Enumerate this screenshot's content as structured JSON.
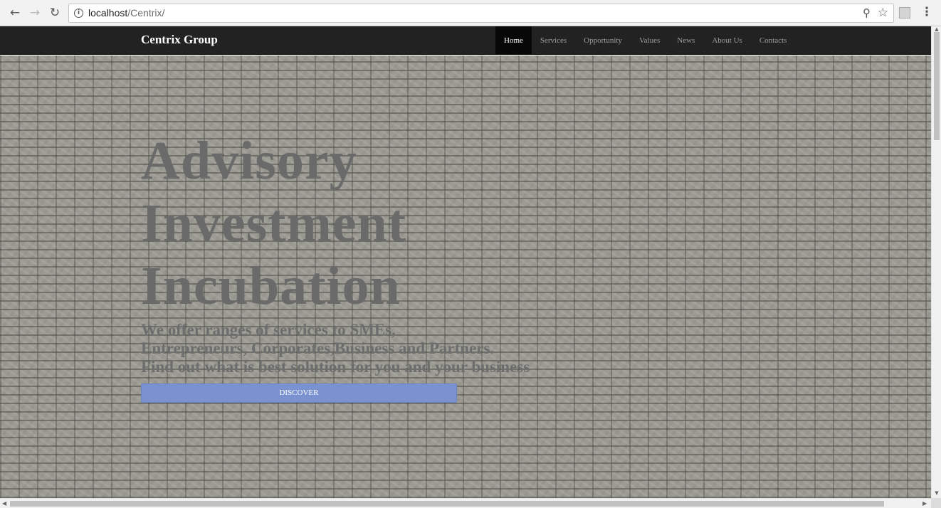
{
  "browser": {
    "url_host": "localhost",
    "url_path": "/Centrix/",
    "icons": {
      "back": "arrow-left-icon",
      "forward": "arrow-right-icon",
      "reload": "reload-icon",
      "info": "info-icon",
      "zoom": "zoom-icon",
      "bookmark": "star-icon",
      "extension": "extension-icon",
      "menu": "kebab-menu-icon"
    }
  },
  "site": {
    "brand": "Centrix Group",
    "nav": [
      {
        "label": "Home",
        "active": true
      },
      {
        "label": "Services",
        "active": false
      },
      {
        "label": "Opportunity",
        "active": false
      },
      {
        "label": "Values",
        "active": false
      },
      {
        "label": "News",
        "active": false
      },
      {
        "label": "About Us",
        "active": false
      },
      {
        "label": "Contacts",
        "active": false
      }
    ]
  },
  "hero": {
    "headline": [
      "Advisory",
      "Investment",
      "Incubation"
    ],
    "subtext": [
      "We offer ranges of services to SMEs,",
      "Entrepreneurs, Corporates,Business and Partners.",
      "Find out what is best solution for you and your business"
    ],
    "button_label": "DISCOVER"
  },
  "colors": {
    "navbar": "#222222",
    "nav_active": "#080808",
    "button": "#7b92d0",
    "headline": "#6a6a6a"
  }
}
